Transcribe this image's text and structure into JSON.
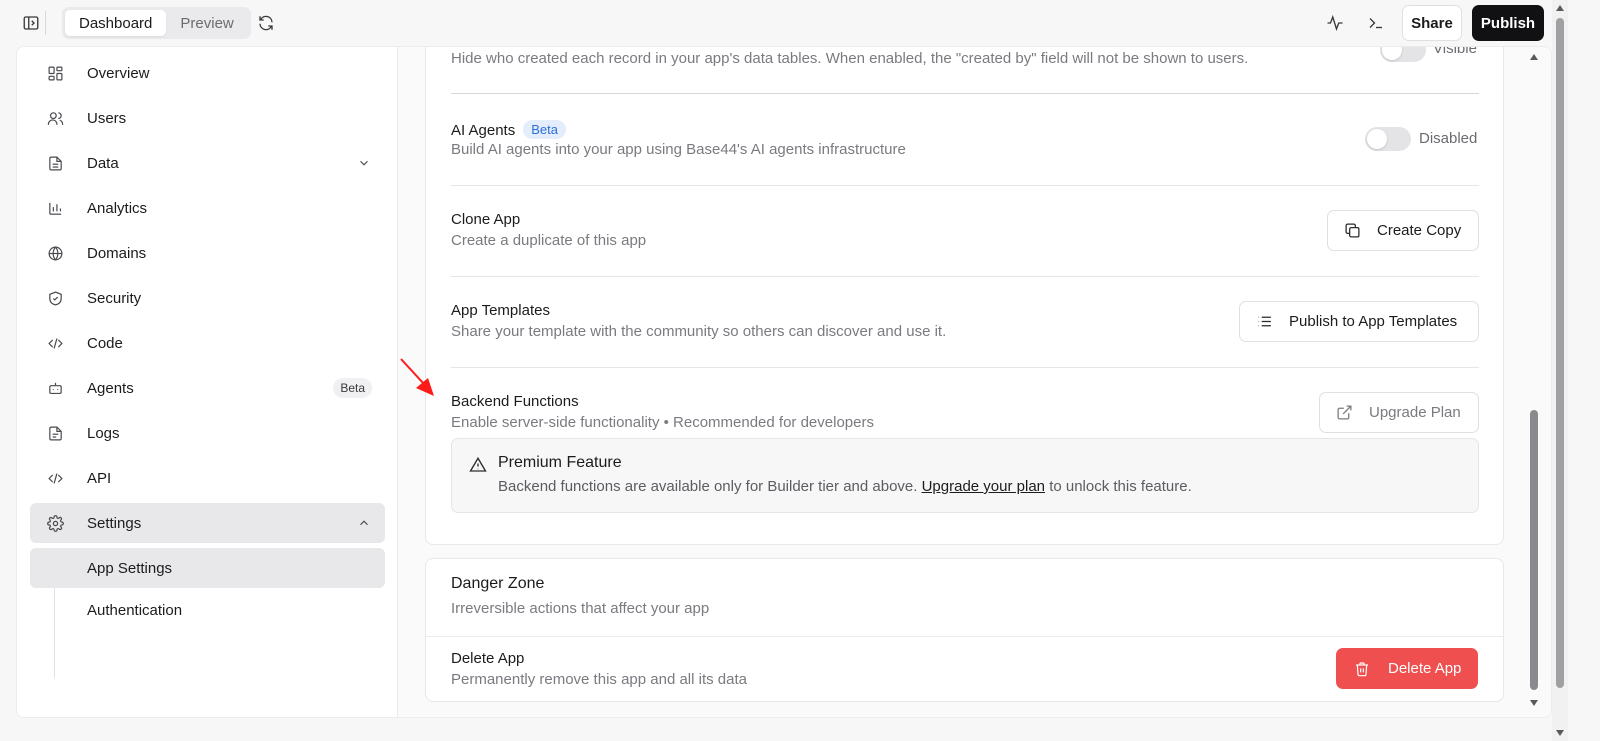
{
  "topbar": {
    "tabs": [
      {
        "label": "Dashboard",
        "active": true
      },
      {
        "label": "Preview",
        "active": false
      }
    ],
    "share_label": "Share",
    "publish_label": "Publish",
    "icons": [
      "sidebar-toggle-icon",
      "refresh-icon",
      "activity-icon",
      "terminal-icon"
    ]
  },
  "sidebar": {
    "items": [
      {
        "label": "Overview",
        "icon": "grid-icon"
      },
      {
        "label": "Users",
        "icon": "users-icon"
      },
      {
        "label": "Data",
        "icon": "file-icon",
        "has_chevron": true
      },
      {
        "label": "Analytics",
        "icon": "bar-chart-icon"
      },
      {
        "label": "Domains",
        "icon": "globe-icon"
      },
      {
        "label": "Security",
        "icon": "shield-icon"
      },
      {
        "label": "Code",
        "icon": "code-icon"
      },
      {
        "label": "Agents",
        "icon": "bot-icon",
        "badge": "Beta"
      },
      {
        "label": "Logs",
        "icon": "document-icon"
      },
      {
        "label": "API",
        "icon": "code-icon"
      },
      {
        "label": "Settings",
        "icon": "gear-icon",
        "expanded": true
      }
    ],
    "sub_items": [
      {
        "label": "App Settings",
        "active": true
      },
      {
        "label": "Authentication",
        "active": false
      }
    ]
  },
  "settings": {
    "created_by": {
      "desc": "Hide who created each record in your app's data tables. When enabled, the \"created by\" field will not be shown to users.",
      "toggle_label": "Visible"
    },
    "ai_agents": {
      "title": "AI Agents",
      "badge": "Beta",
      "desc": "Build AI agents into your app using Base44's AI agents infrastructure",
      "toggle_label": "Disabled"
    },
    "clone_app": {
      "title": "Clone App",
      "desc": "Create a duplicate of this app",
      "button": "Create Copy"
    },
    "app_templates": {
      "title": "App Templates",
      "desc": "Share your template with the community so others can discover and use it.",
      "button": "Publish to App Templates"
    },
    "backend_functions": {
      "title": "Backend Functions",
      "desc": "Enable server-side functionality • Recommended for developers",
      "button": "Upgrade Plan",
      "premium_title": "Premium Feature",
      "premium_desc_before": "Backend functions are available only for Builder tier and above.",
      "premium_link": "Upgrade your plan",
      "premium_desc_after": "to unlock this feature."
    }
  },
  "danger_zone": {
    "title": "Danger Zone",
    "desc": "Irreversible actions that affect your app",
    "delete_title": "Delete App",
    "delete_desc": "Permanently remove this app and all its data",
    "delete_button": "Delete App"
  },
  "colors": {
    "accent_dark": "#111114",
    "danger": "#ef4f4f",
    "beta_badge_bg": "#e3edfc",
    "beta_badge_text": "#2f6fdb",
    "annotation_arrow": "#ff0000"
  }
}
